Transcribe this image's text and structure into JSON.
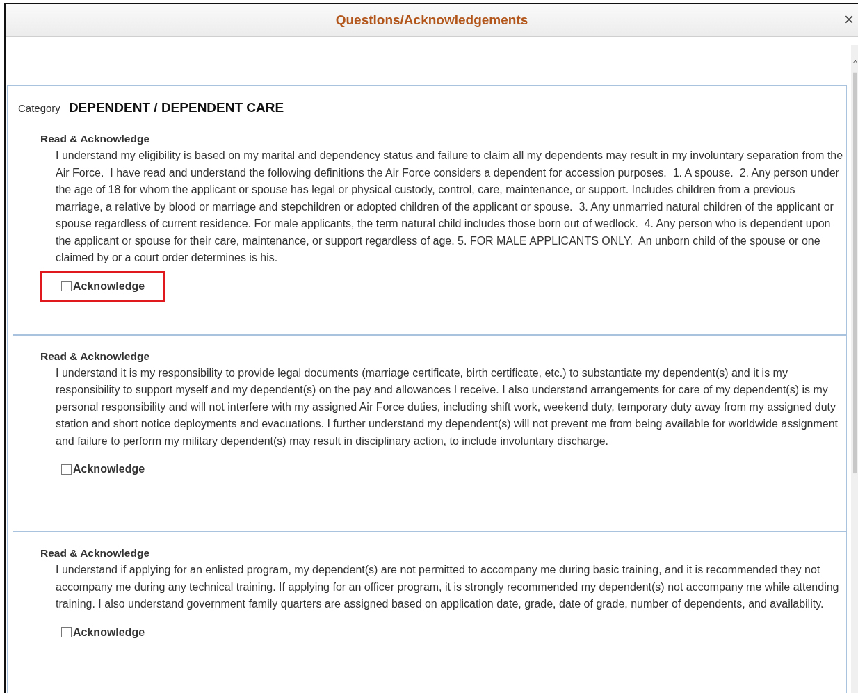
{
  "dialog": {
    "title": "Questions/Acknowledgements",
    "close": "×"
  },
  "category": {
    "label": "Category",
    "value": "DEPENDENT / DEPENDENT CARE"
  },
  "sections": [
    {
      "heading": "Read & Acknowledge",
      "text": "I understand my eligibility is based on my marital and dependency status and failure to claim all my dependents may result in my involuntary separation from the Air Force.  I have read and understand the following definitions the Air Force considers a dependent for accession purposes.  1. A spouse.  2. Any person under the age of 18 for whom the applicant or spouse has legal or physical custody, control, care, maintenance, or support. Includes children from a previous marriage, a relative by blood or marriage and stepchildren or adopted children of the applicant or spouse.  3. Any unmarried natural children of the applicant or spouse regardless of current residence. For male applicants, the term natural child includes those born out of wedlock.  4. Any person who is dependent upon the applicant or spouse for their care, maintenance, or support regardless of age. 5. FOR MALE APPLICANTS ONLY.  An unborn child of the spouse or one claimed by or a court order determines is his.",
      "checkbox": {
        "label": "Acknowledge",
        "checked": false,
        "highlighted": true
      }
    },
    {
      "heading": "Read & Acknowledge",
      "text": "I understand it is my responsibility to provide legal documents (marriage certificate, birth certificate, etc.) to substantiate my dependent(s) and it is my responsibility to support myself and my dependent(s) on the pay and allowances I receive. I also understand arrangements for care of my dependent(s) is my personal responsibility and will not interfere with my assigned Air Force duties, including shift work, weekend duty, temporary duty away from my assigned duty station and short notice deployments and evacuations. I further understand my dependent(s) will not prevent me from being available for worldwide assignment and failure to perform my military dependent(s) may result in disciplinary action, to include involuntary discharge.",
      "checkbox": {
        "label": "Acknowledge",
        "checked": false,
        "highlighted": false
      }
    },
    {
      "heading": "Read & Acknowledge",
      "text": "I understand if applying for an enlisted program, my dependent(s) are not permitted to accompany me during basic training, and it is recommended they not accompany me during any technical training. If applying for an officer program, it is strongly recommended my dependent(s) not accompany me while attending training. I also understand government family quarters are assigned based on application date, grade, date of grade, number of dependents, and availability.",
      "checkbox": {
        "label": "Acknowledge",
        "checked": false,
        "highlighted": false
      }
    }
  ]
}
